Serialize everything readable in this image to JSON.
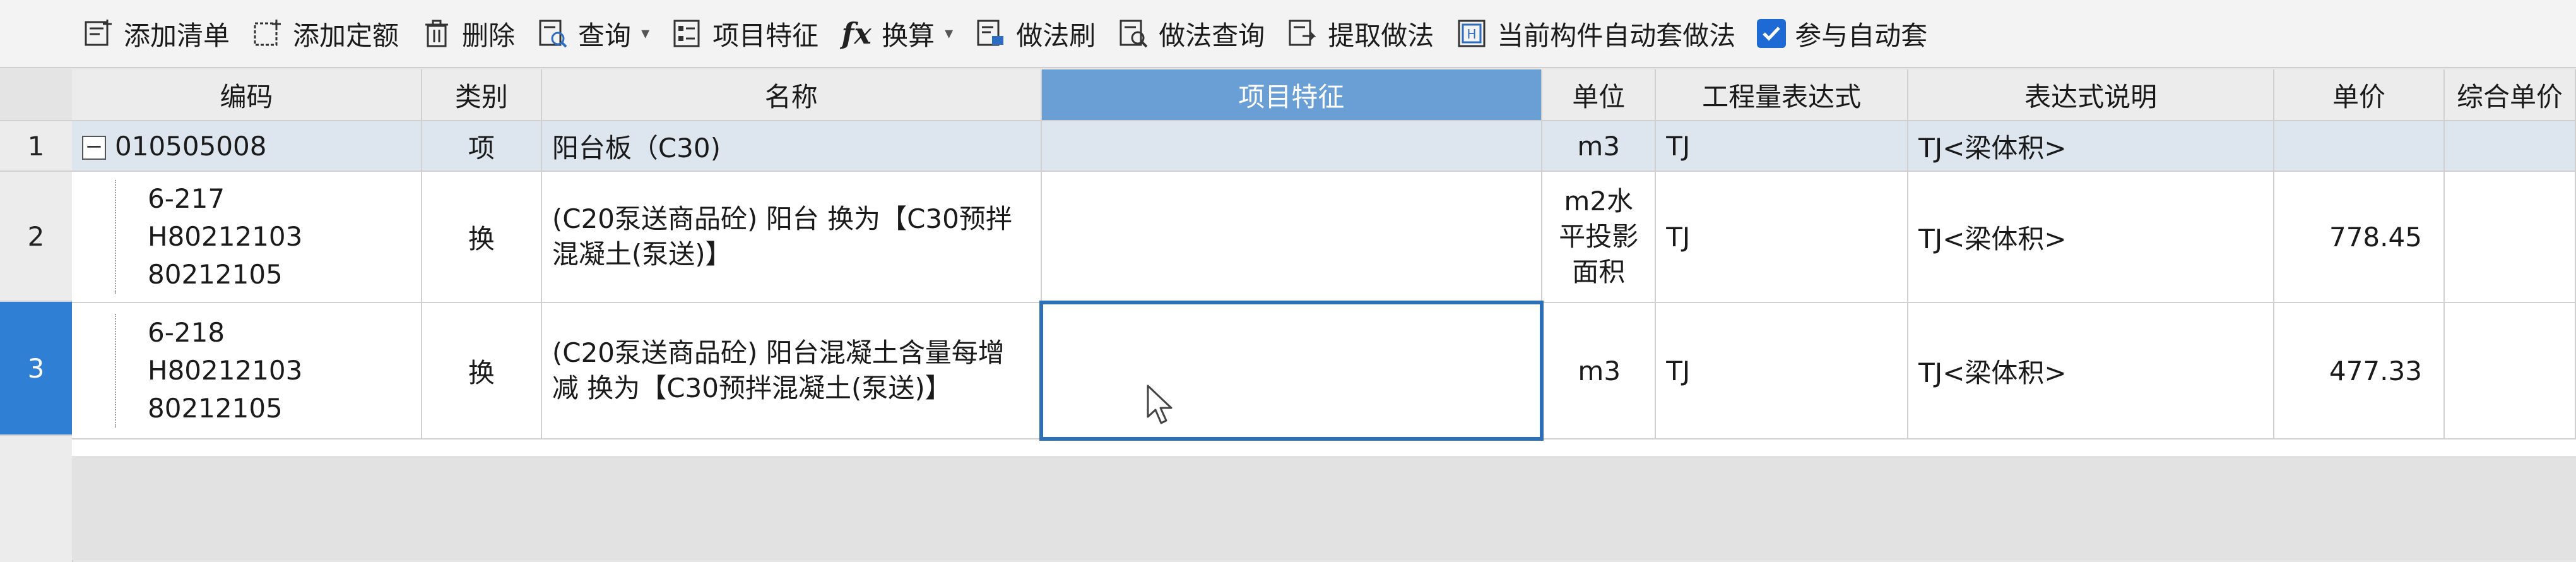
{
  "toolbar": {
    "items": [
      {
        "label": "添加清单",
        "icon": "add-list-icon"
      },
      {
        "label": "添加定额",
        "icon": "add-quota-icon"
      },
      {
        "label": "删除",
        "icon": "trash-icon"
      },
      {
        "label": "查询",
        "icon": "query-icon",
        "dropdown": true
      },
      {
        "label": "项目特征",
        "icon": "feature-icon"
      },
      {
        "label": "换算",
        "icon": "fx-icon",
        "dropdown": true
      },
      {
        "label": "做法刷",
        "icon": "brush-icon"
      },
      {
        "label": "做法查询",
        "icon": "method-query-icon"
      },
      {
        "label": "提取做法",
        "icon": "extract-icon"
      },
      {
        "label": "当前构件自动套做法",
        "icon": "auto-apply-icon"
      },
      {
        "label": "参与自动套",
        "icon": "checkbox-checked-icon",
        "checked": true
      }
    ],
    "fx_glyph": "fx"
  },
  "grid": {
    "columns": [
      "编码",
      "类别",
      "名称",
      "项目特征",
      "单位",
      "工程量表达式",
      "表达式说明",
      "单价",
      "综合单价"
    ],
    "active_column": "项目特征",
    "rows": [
      {
        "num": "1",
        "code": "010505008",
        "type": "项",
        "name": "阳台板（C30)",
        "feature": "",
        "unit": "m3",
        "expr": "TJ",
        "expr_desc": "TJ<梁体积>",
        "price": "",
        "comp_price": ""
      },
      {
        "num": "2",
        "code_lines": [
          "6-217",
          "H80212103",
          "80212105"
        ],
        "type": "换",
        "name": "(C20泵送商品砼) 阳台  换为【C30预拌混凝土(泵送)】",
        "feature": "",
        "unit": "m2水平投影面积",
        "expr": "TJ",
        "expr_desc": "TJ<梁体积>",
        "price": "778.45",
        "comp_price": ""
      },
      {
        "num": "3",
        "code_lines": [
          "6-218",
          "H80212103",
          "80212105"
        ],
        "type": "换",
        "name": "(C20泵送商品砼) 阳台混凝土含量每增减  换为【C30预拌混凝土(泵送)】",
        "feature": "",
        "unit": "m3",
        "expr": "TJ",
        "expr_desc": "TJ<梁体积>",
        "price": "477.33",
        "comp_price": ""
      }
    ],
    "selected_row": "1",
    "active_row": "3"
  },
  "colors": {
    "active_header": "#6a9fd6",
    "active_row_number": "#2f7fd4",
    "selected_row": "#dde5ef",
    "edit_border": "#2e6fb6",
    "checkbox": "#1e6ad4"
  }
}
